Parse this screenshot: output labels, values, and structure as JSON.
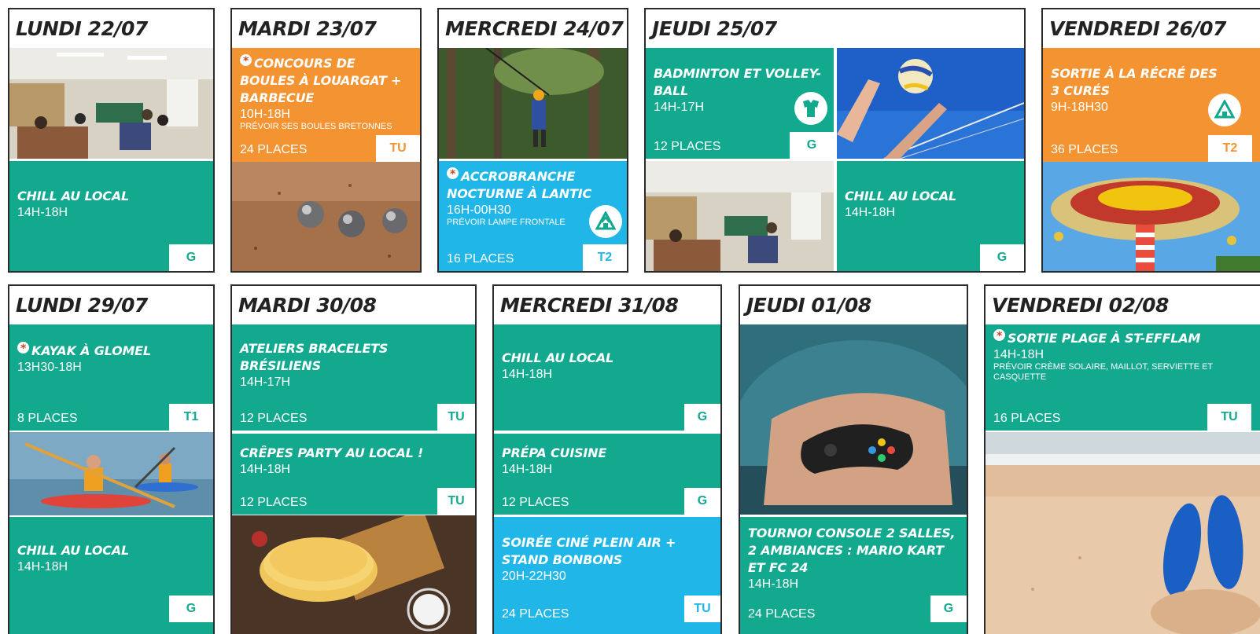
{
  "week1": {
    "mon": {
      "day": "LUNDI 22/07",
      "act": {
        "title": "CHILL AU LOCAL",
        "time": "14H-18H",
        "tag": "G"
      }
    },
    "tue": {
      "day": "MARDI 23/07",
      "act": {
        "title": "CONCOURS DE BOULES À LOUARGAT + BARBECUE",
        "time": "10H-18H",
        "note": "PRÉVOIR SES BOULES BRETONNES",
        "places": "24 PLACES",
        "tag": "TU"
      }
    },
    "wed": {
      "day": "MERCREDI 24/07",
      "act": {
        "title": "ACCROBRANCHE NOCTURNE À LANTIC",
        "time": "16H-00H30",
        "note": "PRÉVOIR LAMPE FRONTALE",
        "places": "16 PLACES",
        "tag": "T2"
      }
    },
    "thu": {
      "day": "JEUDI 25/07",
      "act1": {
        "title": "BADMINTON ET VOLLEY-BALL",
        "time": "14H-17H",
        "places": "12 PLACES",
        "tag": "G"
      },
      "act2": {
        "title": "CHILL AU LOCAL",
        "time": "14H-18H",
        "tag": "G"
      }
    },
    "fri": {
      "day": "VENDREDI 26/07",
      "act": {
        "title": "SORTIE À LA RÉCRÉ DES 3 CURÉS",
        "time": "9H-18H30",
        "places": "36 PLACES",
        "tag": "T2"
      }
    }
  },
  "week2": {
    "mon": {
      "day": "LUNDI 29/07",
      "act1": {
        "title": "KAYAK À GLOMEL",
        "time": "13H30-18H",
        "places": "8 PLACES",
        "tag": "T1"
      },
      "act2": {
        "title": "CHILL AU LOCAL",
        "time": "14H-18H",
        "tag": "G"
      }
    },
    "tue": {
      "day": "MARDI 30/08",
      "act1": {
        "title": "ATELIERS BRACELETS BRÉSILIENS",
        "time": "14H-17H",
        "places": "12 PLACES",
        "tag": "TU"
      },
      "act2": {
        "title": "CRÊPES PARTY AU LOCAL !",
        "time": "14H-18H",
        "places": "12 PLACES",
        "tag": "TU"
      }
    },
    "wed": {
      "day": "MERCREDI 31/08",
      "act1": {
        "title": "CHILL AU LOCAL",
        "time": "14H-18H",
        "tag": "G"
      },
      "act2": {
        "title": "PRÉPA CUISINE",
        "time": "14H-18H",
        "places": "12 PLACES",
        "tag": "G"
      },
      "act3": {
        "title": "SOIRÉE CINÉ PLEIN AIR + STAND BONBONS",
        "time": "20H-22H30",
        "places": "24 PLACES",
        "tag": "TU"
      }
    },
    "thu": {
      "day": "JEUDI 01/08",
      "act": {
        "title": "TOURNOI CONSOLE  2 SALLES, 2 AMBIANCES : MARIO KART ET FC 24",
        "time": "14H-18H",
        "places": "24 PLACES",
        "tag": "G"
      }
    },
    "fri": {
      "day": "VENDREDI 02/08",
      "act": {
        "title": "SORTIE PLAGE À ST-EFFLAM",
        "time": "14H-18H",
        "note": "PRÉVOIR CRÈME SOLAIRE, MAILLOT, SERVIETTE ET CASQUETTE",
        "places": "16 PLACES",
        "tag": "TU"
      }
    }
  },
  "icons": {
    "special_activity": "asterisk-icon",
    "sport_badge": "sport-outfit-icon",
    "outing_badge": "outing-icon"
  },
  "colors": {
    "green": "#12a98f",
    "orange": "#f39332",
    "blue": "#20b6e8",
    "border": "#2b2b2b",
    "star": "#c44a2a"
  }
}
